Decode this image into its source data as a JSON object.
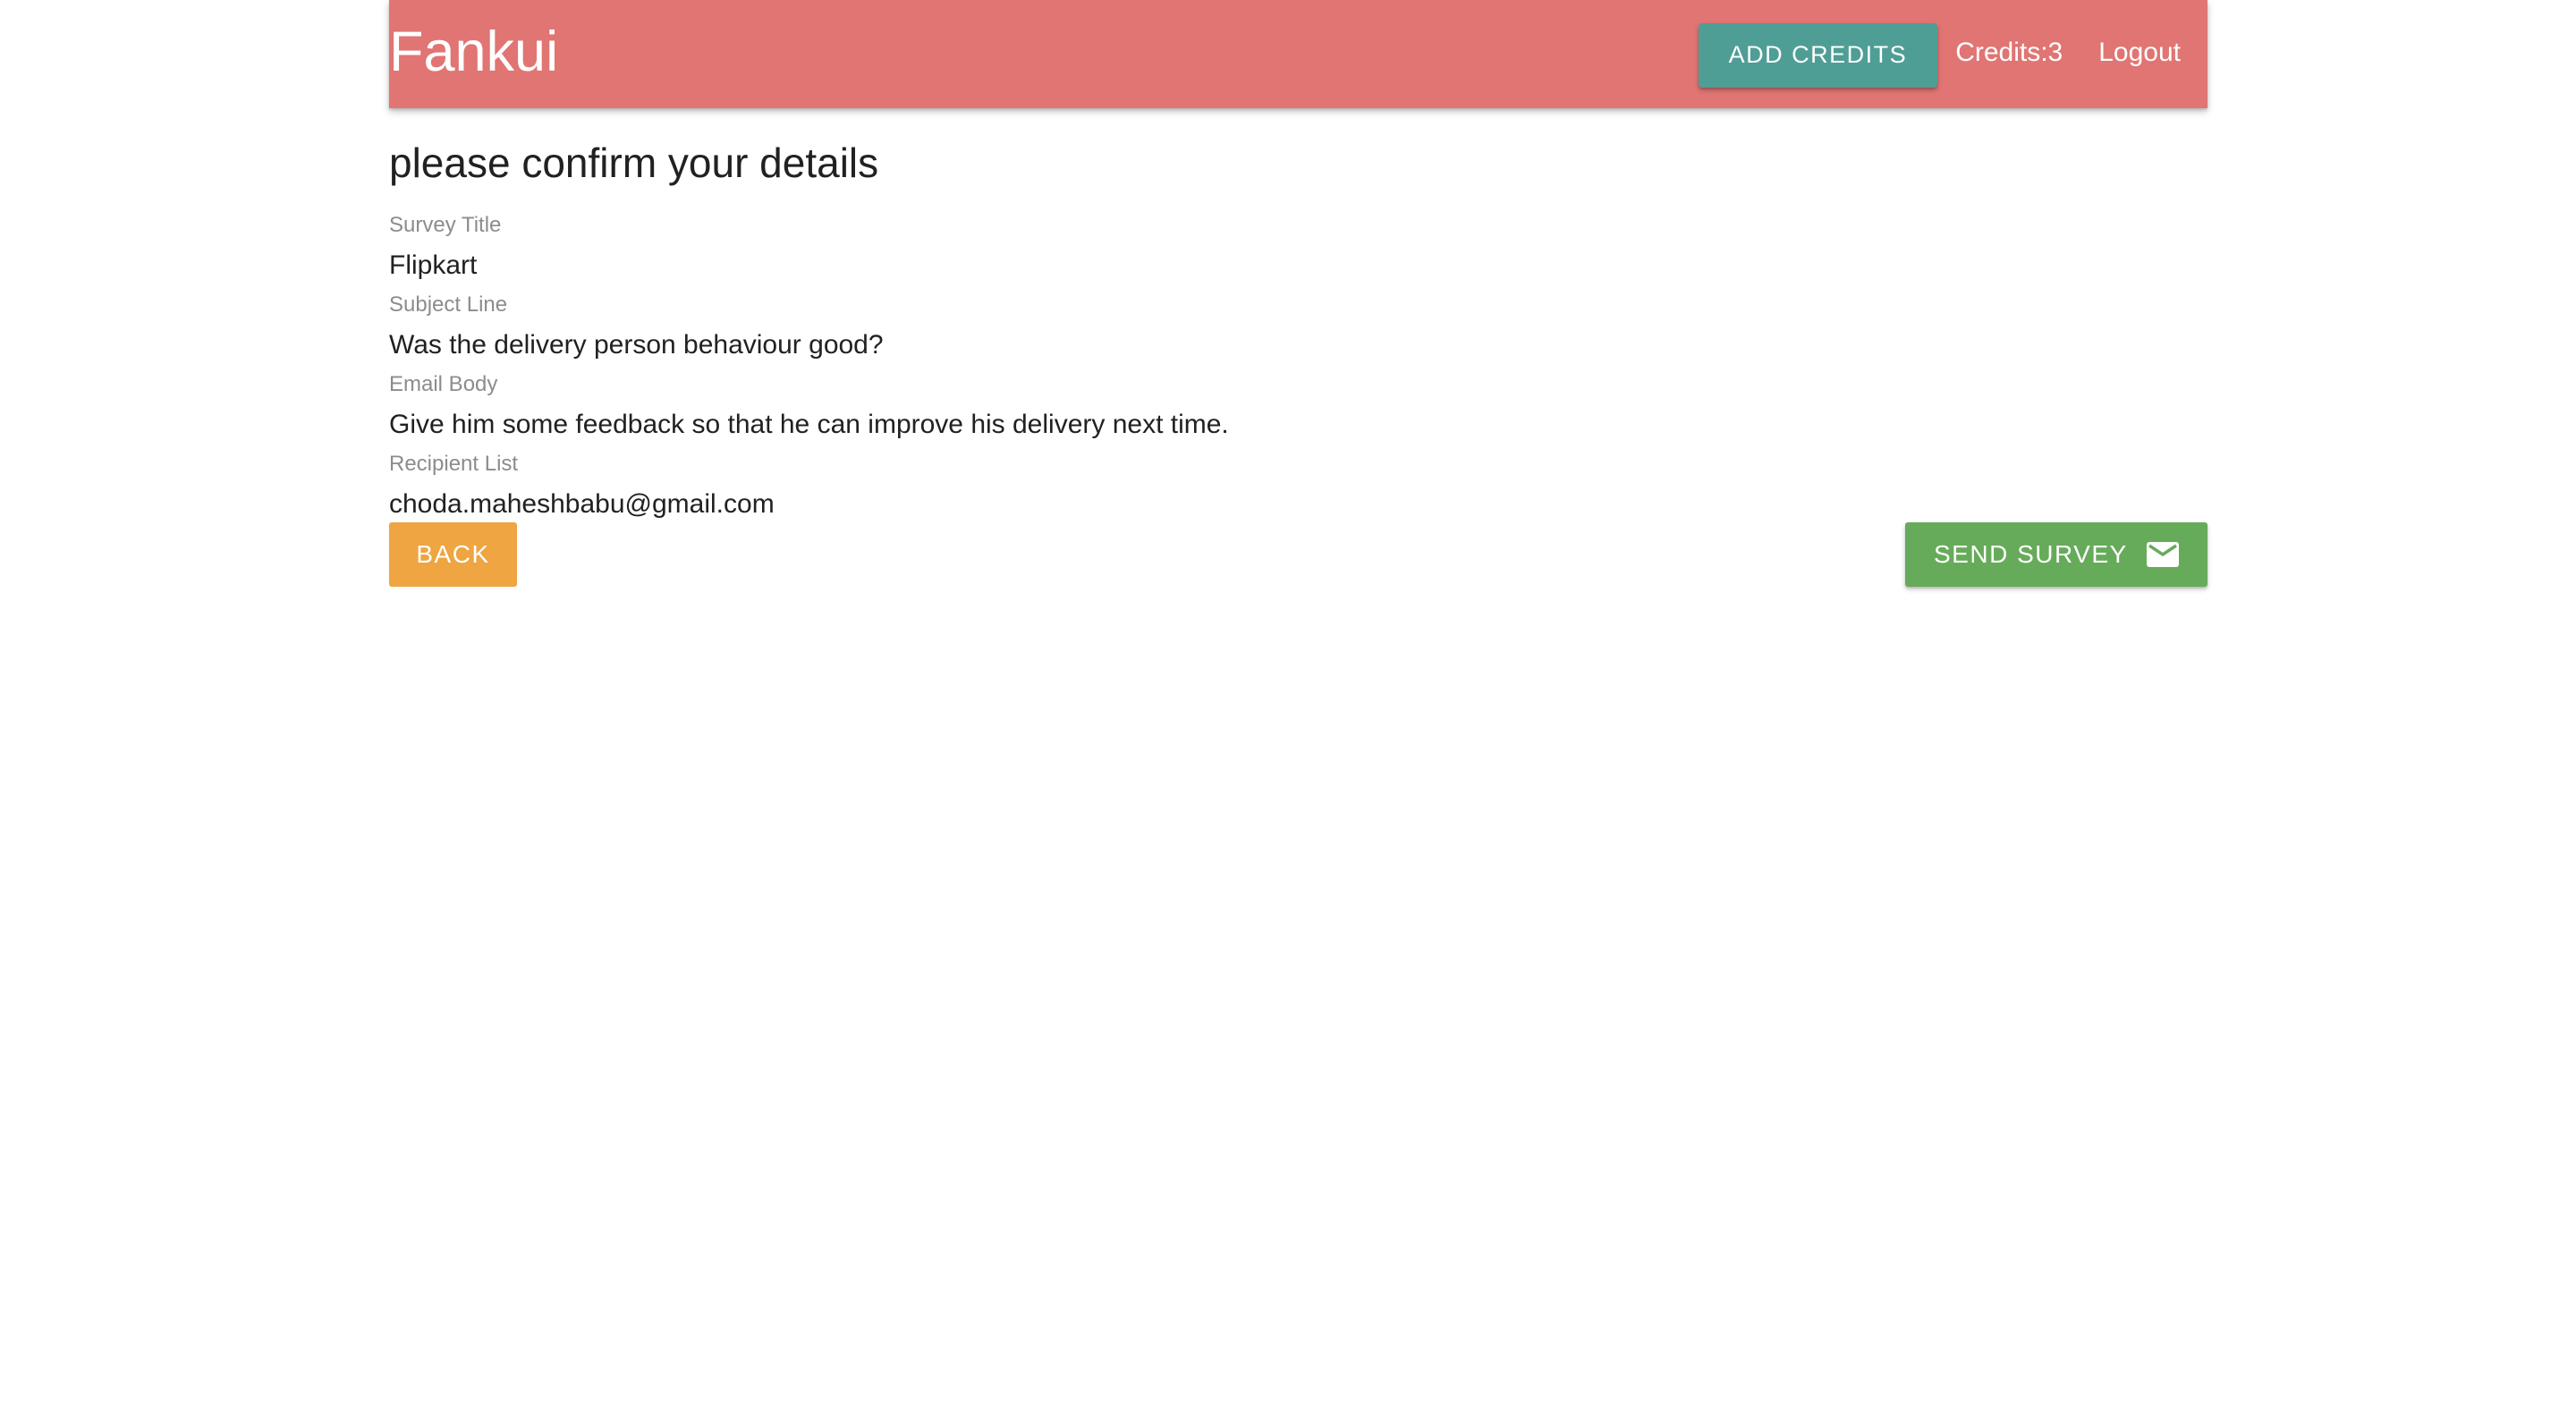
{
  "navbar": {
    "brand": "Fankui",
    "add_credits_label": "ADD CREDITS",
    "credits_text": "Credits:3",
    "logout_label": "Logout",
    "background_color": "#e07573",
    "add_credits_color": "#4f9e95"
  },
  "main": {
    "heading": "please confirm your details",
    "fields": [
      {
        "label": "Survey Title",
        "value": "Flipkart"
      },
      {
        "label": "Subject Line",
        "value": "Was the delivery person behaviour good?"
      },
      {
        "label": "Email Body",
        "value": "Give him some feedback so that he can improve his delivery next time."
      },
      {
        "label": "Recipient List",
        "value": "choda.maheshbabu@gmail.com"
      }
    ]
  },
  "actions": {
    "back_label": "BACK",
    "back_color": "#eea542",
    "send_label": "SEND SURVEY",
    "send_icon": "mail-icon",
    "send_color": "#66ab5a"
  }
}
